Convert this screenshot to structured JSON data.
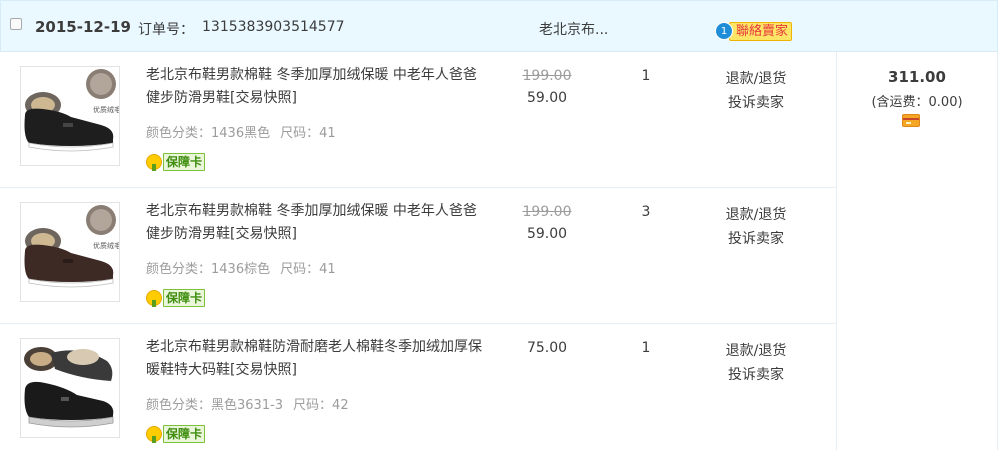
{
  "header": {
    "date": "2015-12-19",
    "order_label": "订单号：",
    "order_number": "1315383903514577",
    "shop_name": "老北京布...",
    "contact_badge": "1",
    "contact_label": "聯絡賣家"
  },
  "items": [
    {
      "title": "老北京布鞋男款棉鞋 冬季加厚加绒保暖 中老年人爸爸健步防滑男鞋[交易快照]",
      "sku_color": "颜色分类：1436黑色",
      "sku_size": "尺码：41",
      "guarantee": "保障卡",
      "thumb_badge": "优质绒毛",
      "original_price": "199.00",
      "price": "59.00",
      "quantity": "1",
      "action_refund": "退款/退货",
      "action_complain": "投诉卖家",
      "shoe_color": "#1e1e1e"
    },
    {
      "title": "老北京布鞋男款棉鞋 冬季加厚加绒保暖 中老年人爸爸健步防滑男鞋[交易快照]",
      "sku_color": "颜色分类：1436棕色",
      "sku_size": "尺码：41",
      "guarantee": "保障卡",
      "thumb_badge": "优质绒毛",
      "original_price": "199.00",
      "price": "59.00",
      "quantity": "3",
      "action_refund": "退款/退货",
      "action_complain": "投诉卖家",
      "shoe_color": "#3d2a24"
    },
    {
      "title": "老北京布鞋男款棉鞋防滑耐磨老人棉鞋冬季加绒加厚保暖鞋特大码鞋[交易快照]",
      "sku_color": "颜色分类：黑色3631-3",
      "sku_size": "尺码：42",
      "guarantee": "保障卡",
      "price": "75.00",
      "quantity": "1",
      "action_refund": "退款/退货",
      "action_complain": "投诉卖家",
      "shoe_color": "#1a1a1a"
    }
  ],
  "summary": {
    "total": "311.00",
    "shipping": "(含运费：0.00)"
  },
  "colors": {
    "header_bg": "#eaf8ff",
    "strike_price": "#9c9c9c",
    "guarantee_green": "#3f8d0f",
    "contact_red": "#e4393c"
  }
}
